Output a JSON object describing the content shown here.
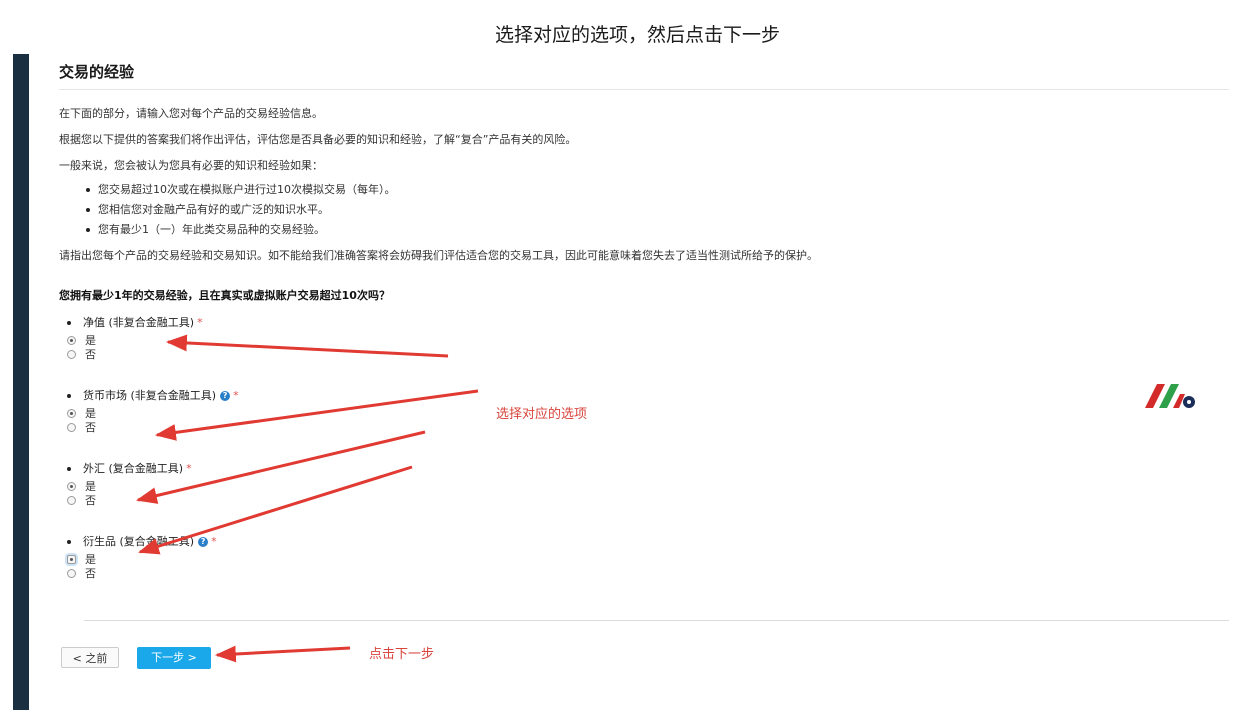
{
  "caption": "选择对应的选项，然后点击下一步",
  "section": {
    "title": "交易的经验",
    "intro": "在下面的部分，请输入您对每个产品的交易经验信息。",
    "assessment": "根据您以下提供的答案我们将作出评估，评估您是否具备必要的知识和经验，了解“复合”产品有关的风险。",
    "lead": "一般来说，您会被认为您具有必要的知识和经验如果：",
    "bullets": [
      "您交易超过10次或在模拟账户进行过10次模拟交易（每年）。",
      "您相信您对金融产品有好的或广泛的知识水平。",
      "您有最少1（一）年此类交易品种的交易经验。"
    ],
    "notice": "请指出您每个产品的交易经验和交易知识。如不能给我们准确答案将会妨碍我们评估适合您的交易工具，因此可能意味着您失去了适当性测试所给予的保护。"
  },
  "question": "您拥有最少1年的交易经验，且在真实或虚拟账户交易超过10次吗？",
  "groups": [
    {
      "label": "净值 (非复合金融工具)",
      "required": "*",
      "yes": "是",
      "no": "否",
      "selected": "是"
    },
    {
      "label": "货币市场 (非复合金融工具)",
      "required": "*",
      "help": "?",
      "yes": "是",
      "no": "否",
      "selected": "是"
    },
    {
      "label": "外汇 (复合金融工具)",
      "required": "*",
      "yes": "是",
      "no": "否",
      "selected": "是"
    },
    {
      "label": "衍生品 (复合金融工具)",
      "required": "*",
      "help": "?",
      "yes": "是",
      "no": "否",
      "selected": "是"
    }
  ],
  "annotations": {
    "select_option": "选择对应的选项",
    "click_next": "点击下一步"
  },
  "buttons": {
    "prev": "< 之前",
    "next": "下一步 >"
  },
  "colors": {
    "left_bar": "#1a3040",
    "accent_button": "#1ba8ea",
    "annotation_red": "#d9443c",
    "logo_red": "#d32a2a",
    "logo_green": "#2ea04a",
    "logo_navy": "#1d2d5a"
  }
}
